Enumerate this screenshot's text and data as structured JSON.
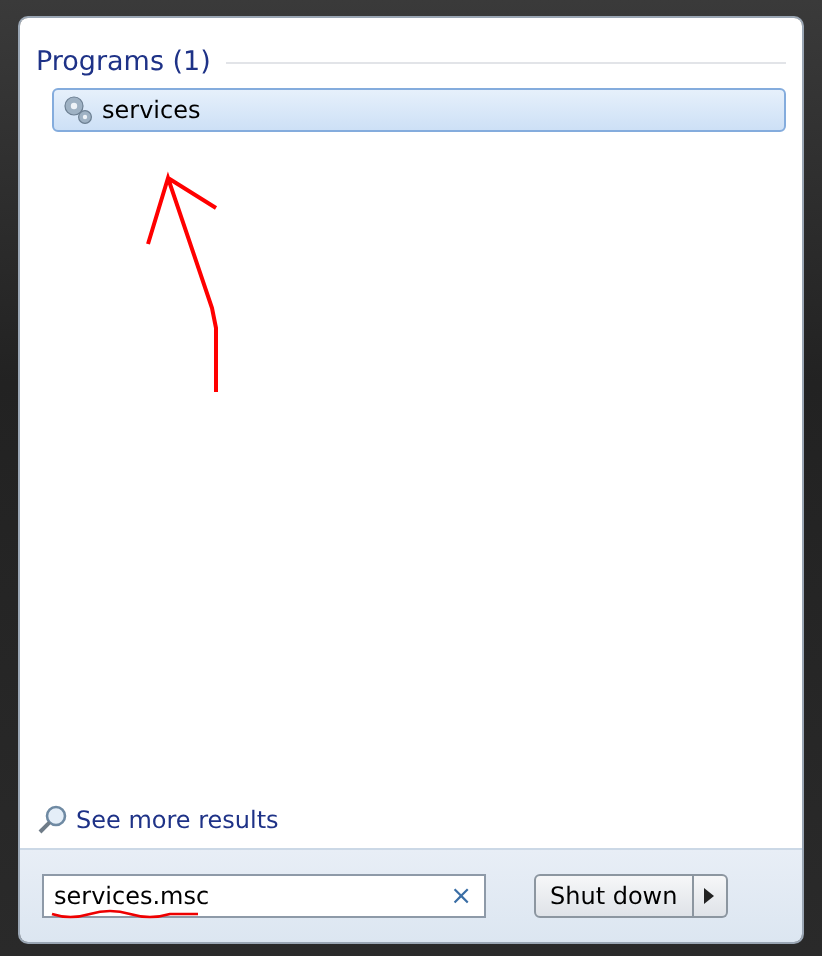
{
  "results": {
    "heading": "Programs (1)",
    "items": [
      {
        "label": "services",
        "selected": true
      }
    ]
  },
  "see_more": "See more results",
  "search": {
    "value": "services.msc",
    "clear": "×"
  },
  "shutdown": {
    "label": "Shut down"
  }
}
